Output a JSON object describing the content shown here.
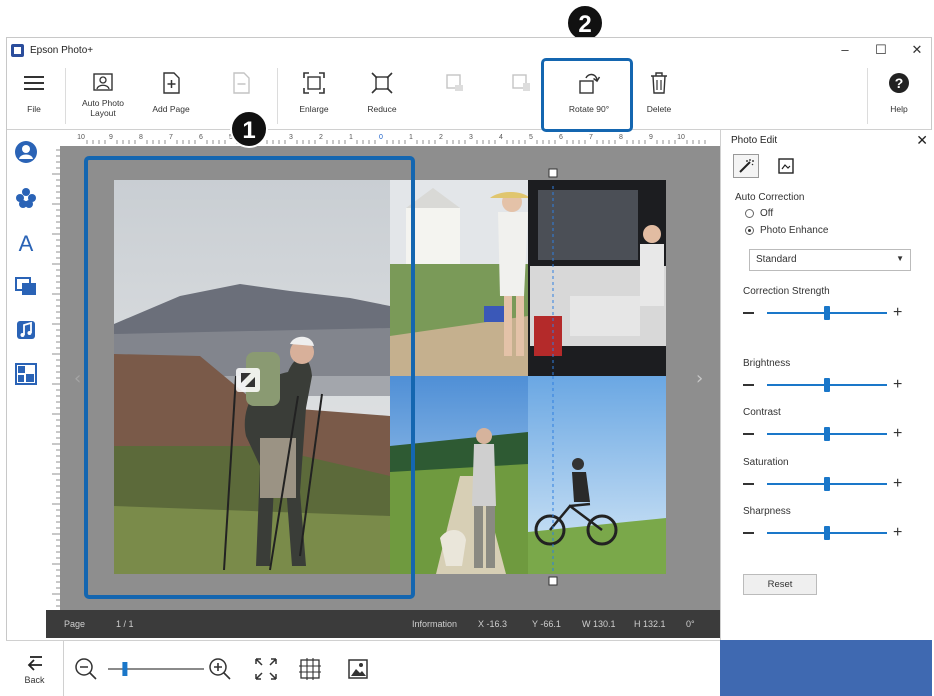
{
  "window": {
    "title": "Epson Photo+",
    "controls": {
      "minimize": "–",
      "maximize": "☐",
      "close": "✕"
    }
  },
  "ribbon": {
    "file": "File",
    "auto_layout": "Auto Photo\nLayout",
    "add_page": "Add Page",
    "enlarge": "Enlarge",
    "reduce": "Reduce",
    "rotate": "Rotate 90°",
    "delete": "Delete",
    "help": "Help"
  },
  "callouts": {
    "one": "1",
    "two": "2"
  },
  "accent_color": "#1466b0",
  "ruler_labels": [
    "10",
    "9",
    "8",
    "7",
    "6",
    "5",
    "4",
    "3",
    "2",
    "1",
    "0",
    "1",
    "2",
    "3",
    "4",
    "5",
    "6",
    "7",
    "8",
    "9",
    "10"
  ],
  "left_tools": [
    "person-icon",
    "flower-icon",
    "text-icon",
    "layers-icon",
    "music-icon",
    "layout-icon"
  ],
  "status": {
    "page_label": "Page",
    "page_value": "1 / 1",
    "info_label": "Information",
    "x": "X -16.3",
    "y": "Y -66.1",
    "w": "W 130.1",
    "h": "H 132.1",
    "angle": "0°"
  },
  "panel": {
    "title": "Photo Edit",
    "auto_correction_label": "Auto Correction",
    "options": [
      "Off",
      "Photo Enhance"
    ],
    "selected_option": "Photo Enhance",
    "mode_value": "Standard",
    "sliders": [
      {
        "label": "Correction Strength",
        "value": 0.5
      },
      {
        "label": "Brightness",
        "value": 0.5
      },
      {
        "label": "Contrast",
        "value": 0.5
      },
      {
        "label": "Saturation",
        "value": 0.5
      },
      {
        "label": "Sharpness",
        "value": 0.5
      }
    ],
    "reset": "Reset"
  },
  "bottom": {
    "back": "Back",
    "zoom_level": 0.15
  }
}
